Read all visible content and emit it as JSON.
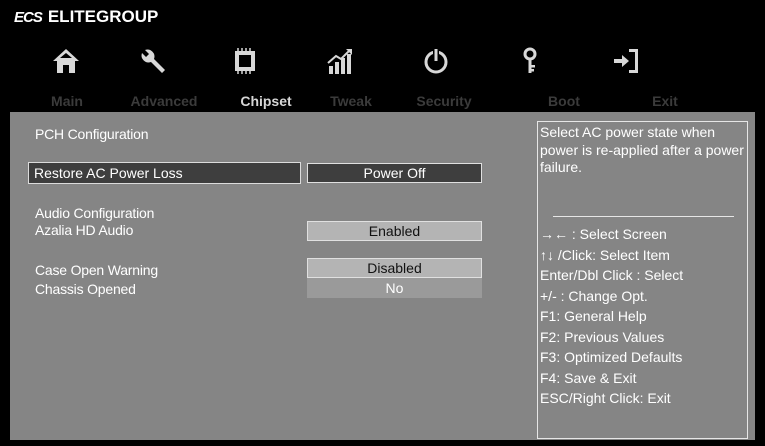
{
  "brand": {
    "logo": "ECS",
    "name": "ELITEGROUP"
  },
  "nav": {
    "icons": [
      "home-icon",
      "wrench-icon",
      "chip-icon",
      "chart-icon",
      "power-icon",
      "key-icon",
      "exit-icon"
    ],
    "tabs": [
      {
        "label": "Main",
        "active": false
      },
      {
        "label": "Advanced",
        "active": false
      },
      {
        "label": "Chipset",
        "active": true
      },
      {
        "label": "Tweak",
        "active": false
      },
      {
        "label": "Security",
        "active": false
      },
      {
        "label": "Boot",
        "active": false
      },
      {
        "label": "Exit",
        "active": false
      }
    ]
  },
  "content": {
    "section_title": "PCH Configuration",
    "restore_ac": {
      "label": "Restore AC Power Loss",
      "value": "Power Off"
    },
    "audio_title": "Audio Configuration",
    "azalia": {
      "label": "Azalia HD Audio",
      "value": "Enabled"
    },
    "case_open": {
      "label": "Case Open Warning",
      "value": "Disabled"
    },
    "chassis": {
      "label": "Chassis Opened",
      "value": "No"
    }
  },
  "help": {
    "description": "Select AC power state when power is re-applied after a power failure.",
    "keys": [
      "→←    : Select Screen",
      "↑↓ /Click: Select Item",
      "Enter/Dbl Click : Select",
      "+/- : Change Opt.",
      "F1: General Help",
      "F2: Previous Values",
      "F3: Optimized Defaults",
      "F4: Save & Exit",
      "ESC/Right Click: Exit"
    ]
  },
  "colors": {
    "panel": "#858585",
    "selected": "#3e3e3e",
    "value_box": "#b4b4b4",
    "tab_active": "#d6d6d6",
    "tab_inactive": "#3b3b3b"
  }
}
